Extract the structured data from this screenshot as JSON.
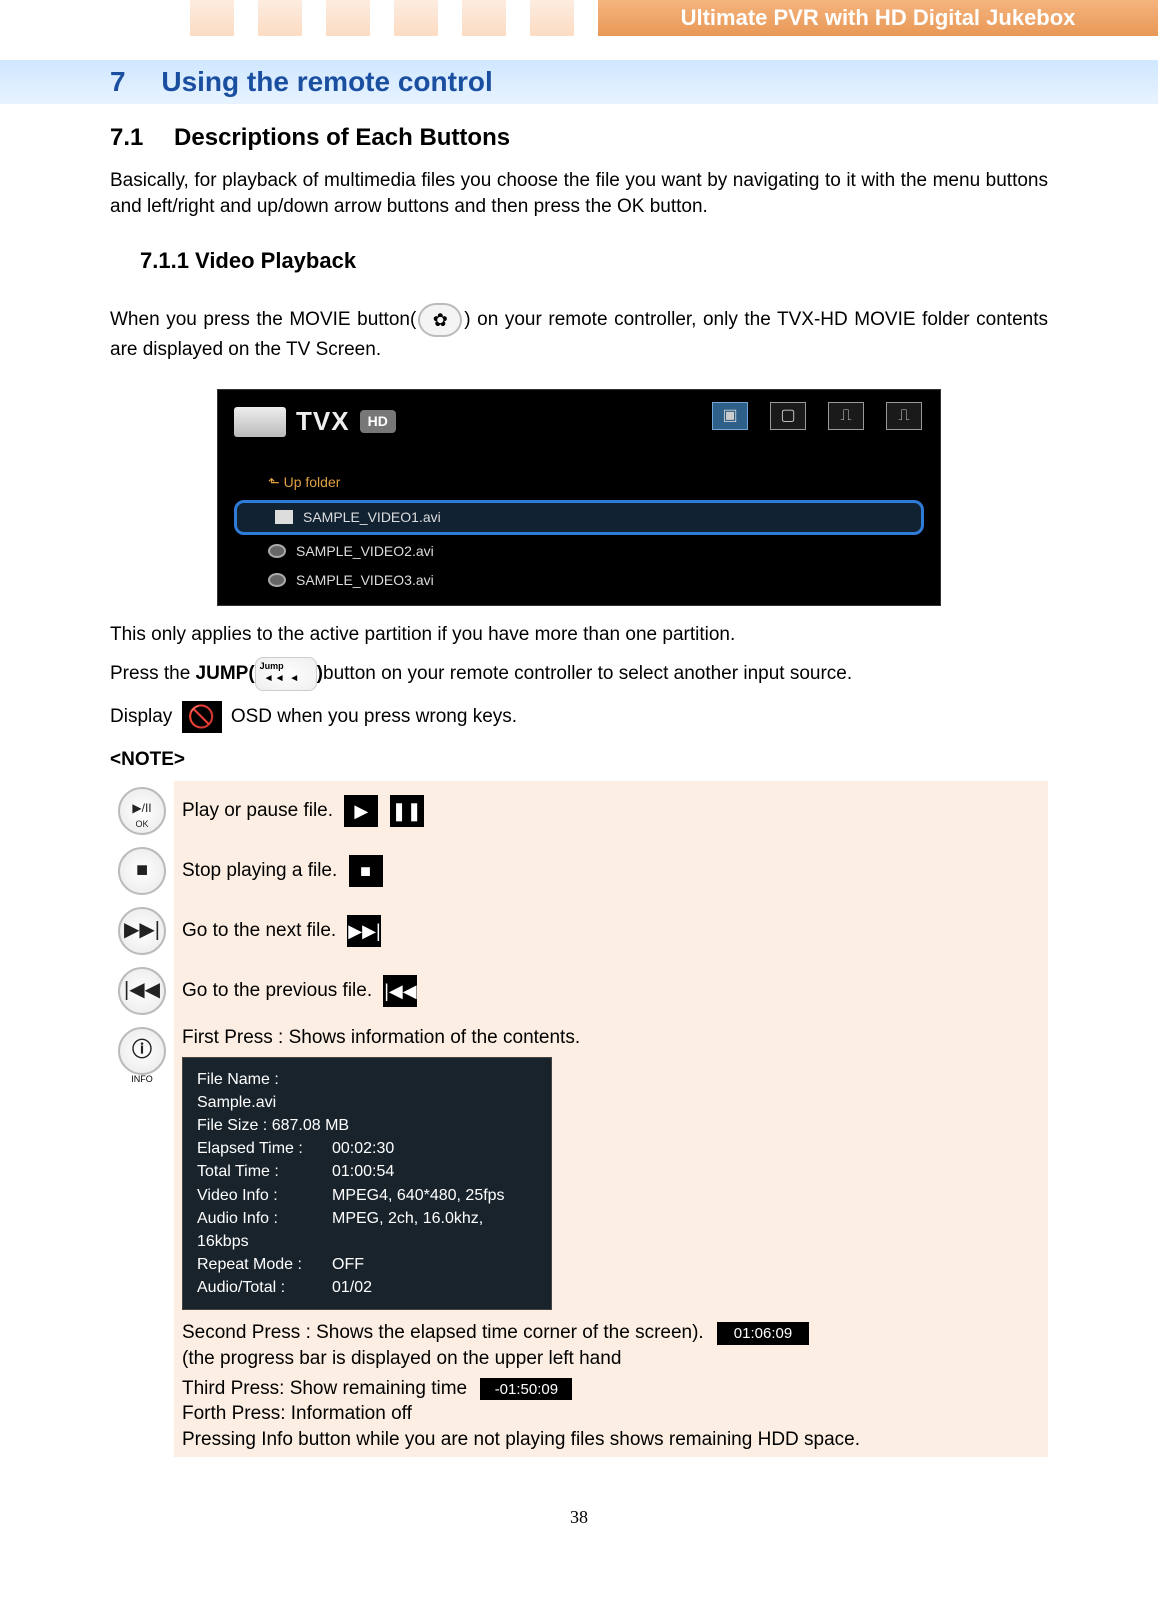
{
  "header": {
    "banner": "Ultimate PVR with HD Digital Jukebox"
  },
  "section": {
    "num": "7",
    "title": "Using the remote control"
  },
  "sub71": {
    "num": "7.1",
    "title": "Descriptions of Each Buttons",
    "intro": "Basically, for playback of multimedia files you choose the file you want by navigating to it with the menu buttons and left/right and up/down arrow buttons and then press the OK button."
  },
  "sub711": {
    "title": "7.1.1 Video Playback",
    "p1a": "When you press the MOVIE button(",
    "p1b": ") on your remote controller, only the TVX-HD MOVIE folder contents are displayed on the TV Screen.",
    "p2": "This only applies to the active partition if you have more than one partition.",
    "p3a": "Press the ",
    "p3jump": "JUMP(",
    "p3b": ")",
    "p3c": "button on your remote controller to select another input source.",
    "p4a": "Display ",
    "p4b": " OSD when you press wrong keys."
  },
  "screen": {
    "logo": "TVX",
    "hd": "HD",
    "up": "Up folder",
    "files": [
      "SAMPLE_VIDEO1.avi",
      "SAMPLE_VIDEO2.avi",
      "SAMPLE_VIDEO3.avi"
    ]
  },
  "noteLabel": "<NOTE>",
  "noteRows": {
    "r1": "Play or pause file.",
    "r2": "Stop playing a file.",
    "r3": "Go to the next file.",
    "r4": "Go to the previous file.",
    "r5": {
      "first": "First Press : Shows information of the contents.",
      "second": "Second Press : Shows the elapsed time corner of the screen).",
      "secondSub": "(the progress bar is displayed on the upper left hand",
      "third": "Third Press: Show remaining time",
      "fourth": "Forth Press: Information off",
      "fifth": "Pressing Info button while you are not playing files shows remaining HDD space."
    }
  },
  "infoPanel": {
    "fileNameLabel": "File Name :",
    "fileName": "Sample.avi",
    "fileSizeLabel": "File Size : 687.08 MB",
    "elapsedLabel": "Elapsed Time :",
    "elapsed": "00:02:30",
    "totalLabel": "Total Time :",
    "total": "01:00:54",
    "videoLabel": "Video Info :",
    "video": "MPEG4, 640*480, 25fps",
    "audioLabel": "Audio Info :",
    "audio": "MPEG, 2ch, 16.0khz, 16kbps",
    "repeatLabel": "Repeat Mode :",
    "repeat": "OFF",
    "audioTotalLabel": "Audio/Total :",
    "audioTotal": "01/02"
  },
  "timeOsd": {
    "elapsed": "01:06:09",
    "remaining": "-01:50:09"
  },
  "btnLabels": {
    "playOk": "▶/II",
    "ok": "OK",
    "info": "INFO"
  },
  "pageNum": "38"
}
